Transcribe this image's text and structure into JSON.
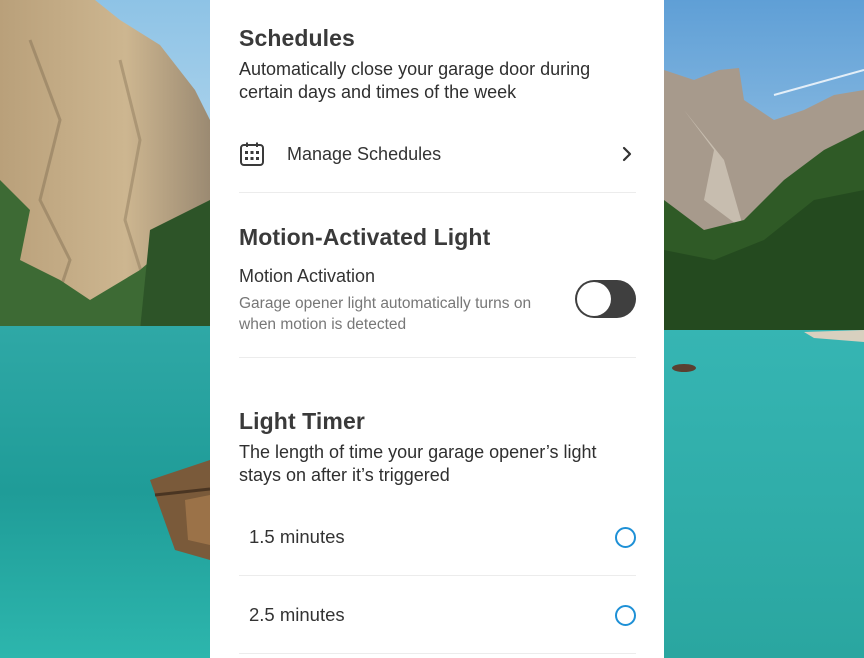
{
  "schedules": {
    "title": "Schedules",
    "description": "Automatically close your garage door during certain days and times of the week",
    "manage_label": "Manage Schedules"
  },
  "motion_light": {
    "title": "Motion-Activated Light",
    "activation_label": "Motion Activation",
    "activation_description": "Garage opener light automatically turns on when motion is detected",
    "toggle_on": false
  },
  "light_timer": {
    "title": "Light Timer",
    "description": "The length of time your garage opener’s light stays on after it’s triggered",
    "options": [
      {
        "label": "1.5 minutes",
        "selected": false
      },
      {
        "label": "2.5 minutes",
        "selected": false
      }
    ]
  },
  "icons": {
    "calendar": "calendar-icon",
    "chevron": "chevron-right-icon"
  },
  "colors": {
    "radio_accent": "#1e90d6",
    "toggle_off": "#3f3f3f"
  }
}
